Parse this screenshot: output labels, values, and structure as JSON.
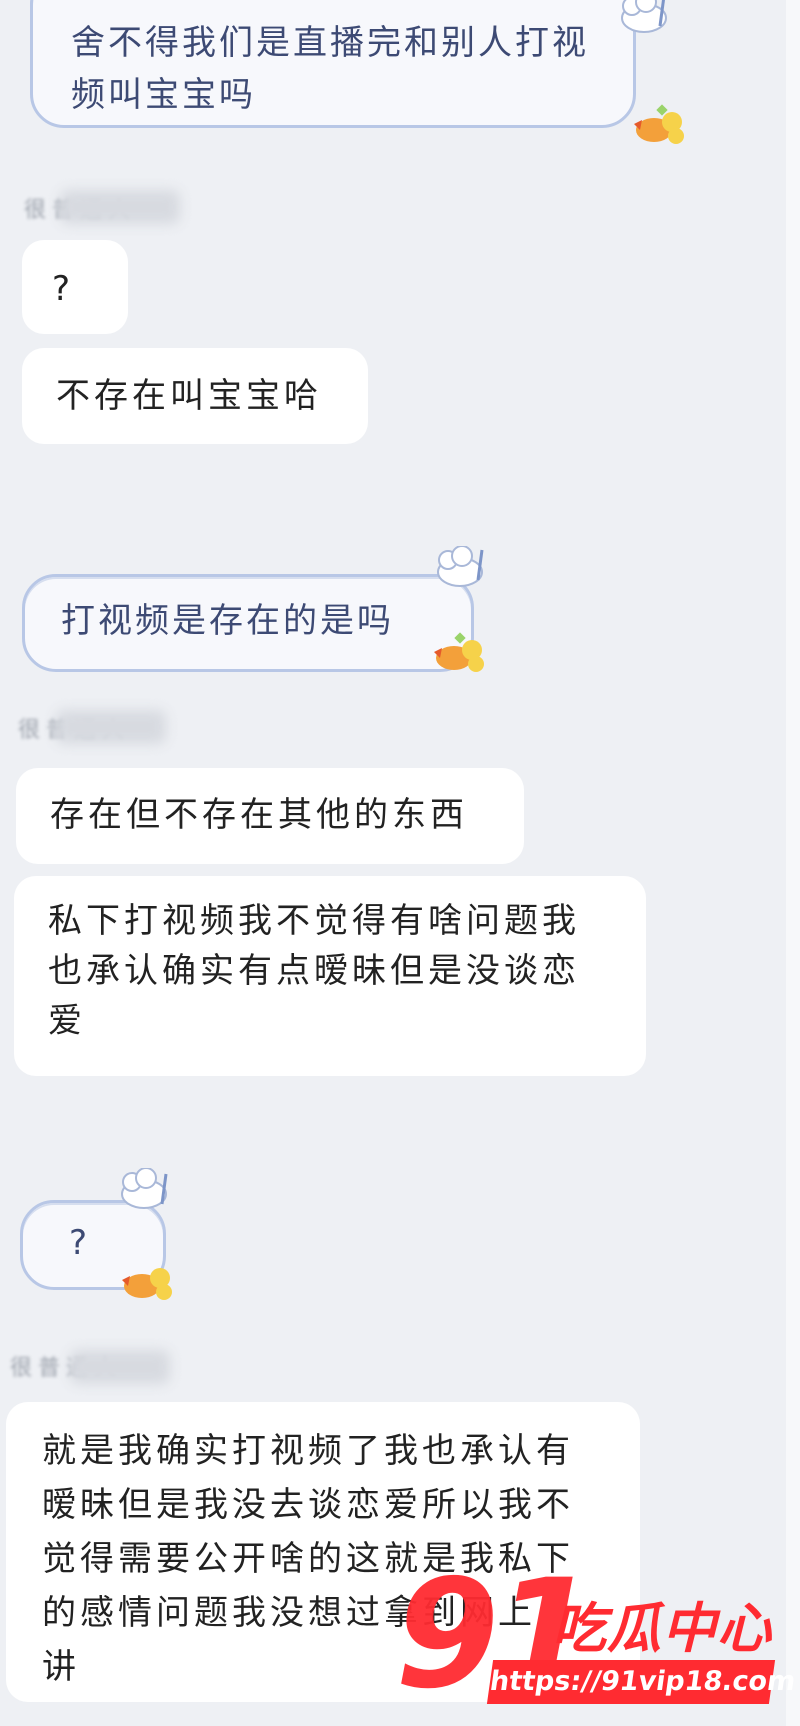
{
  "messages": {
    "m1": "舍不得我们是直播完和别人打视频叫宝宝吗",
    "m1_line1": "舍不得我们是直播完和别人打视",
    "m1_line2": "频叫宝宝吗",
    "name1": "很普通人",
    "m2": "?",
    "m3": "不存在叫宝宝哈",
    "m4": "打视频是存在的是吗",
    "name2": "很普通人",
    "m5": "存在但不存在其他的东西",
    "m6_line1": "私下打视频我不觉得有啥问题我",
    "m6_line2": "也承认确实有点暧昧但是没谈恋",
    "m6_line3": "爱",
    "m7": "?",
    "name3": "很普通人",
    "m8_line1": "就是我确实打视频了我也承认有",
    "m8_line2": "暧昧但是我没去谈恋爱所以我不",
    "m8_line3": "觉得需要公开啥的这就是我私下",
    "m8_line4": "的感情问题我没想过拿到网上",
    "m8_line5": "讲"
  },
  "watermark": {
    "number": "91",
    "brand": "吃瓜中心",
    "url": "https://91vip18.com"
  },
  "colors": {
    "background": "#eef0f4",
    "bubble": "#ffffff",
    "deco_border": "#b8c7e6",
    "deco_text": "#3d4a74",
    "watermark": "#ff2b31"
  }
}
